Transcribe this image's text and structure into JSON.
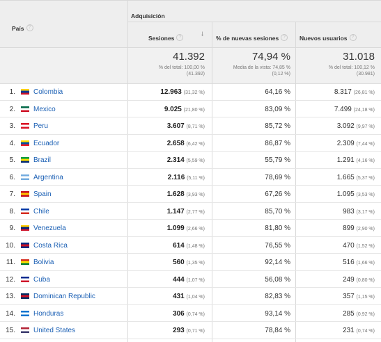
{
  "header": {
    "dimension_label": "País",
    "group_label": "Adquisición",
    "columns": [
      {
        "label": "Sesiones"
      },
      {
        "label": "% de nuevas sesiones"
      },
      {
        "label": "Nuevos usuarios"
      }
    ]
  },
  "totals": {
    "sesiones": {
      "value": "41.392",
      "line1": "% del total: 100,00 %",
      "line2": "(41.392)"
    },
    "nuevas": {
      "value": "74,94 %",
      "line1": "Media de la vista: 74,85 %",
      "line2": "(0,12 %)"
    },
    "nuevos_usuarios": {
      "value": "31.018",
      "line1": "% del total: 100,12 %",
      "line2": "(30.981)"
    }
  },
  "rows": [
    {
      "index": "1.",
      "country": "Colombia",
      "sesiones": "12.963",
      "sesiones_pct": "(31,32 %)",
      "nuevas": "64,16 %",
      "nuevos_usuarios": "8.317",
      "nu_pct": "(26,81 %)"
    },
    {
      "index": "2.",
      "country": "Mexico",
      "sesiones": "9.025",
      "sesiones_pct": "(21,80 %)",
      "nuevas": "83,09 %",
      "nuevos_usuarios": "7.499",
      "nu_pct": "(24,18 %)"
    },
    {
      "index": "3.",
      "country": "Peru",
      "sesiones": "3.607",
      "sesiones_pct": "(8,71 %)",
      "nuevas": "85,72 %",
      "nuevos_usuarios": "3.092",
      "nu_pct": "(9,97 %)"
    },
    {
      "index": "4.",
      "country": "Ecuador",
      "sesiones": "2.658",
      "sesiones_pct": "(6,42 %)",
      "nuevas": "86,87 %",
      "nuevos_usuarios": "2.309",
      "nu_pct": "(7,44 %)"
    },
    {
      "index": "5.",
      "country": "Brazil",
      "sesiones": "2.314",
      "sesiones_pct": "(5,59 %)",
      "nuevas": "55,79 %",
      "nuevos_usuarios": "1.291",
      "nu_pct": "(4,16 %)"
    },
    {
      "index": "6.",
      "country": "Argentina",
      "sesiones": "2.116",
      "sesiones_pct": "(5,11 %)",
      "nuevas": "78,69 %",
      "nuevos_usuarios": "1.665",
      "nu_pct": "(5,37 %)"
    },
    {
      "index": "7.",
      "country": "Spain",
      "sesiones": "1.628",
      "sesiones_pct": "(3,93 %)",
      "nuevas": "67,26 %",
      "nuevos_usuarios": "1.095",
      "nu_pct": "(3,53 %)"
    },
    {
      "index": "8.",
      "country": "Chile",
      "sesiones": "1.147",
      "sesiones_pct": "(2,77 %)",
      "nuevas": "85,70 %",
      "nuevos_usuarios": "983",
      "nu_pct": "(3,17 %)"
    },
    {
      "index": "9.",
      "country": "Venezuela",
      "sesiones": "1.099",
      "sesiones_pct": "(2,66 %)",
      "nuevas": "81,80 %",
      "nuevos_usuarios": "899",
      "nu_pct": "(2,90 %)"
    },
    {
      "index": "10.",
      "country": "Costa Rica",
      "sesiones": "614",
      "sesiones_pct": "(1,48 %)",
      "nuevas": "76,55 %",
      "nuevos_usuarios": "470",
      "nu_pct": "(1,52 %)"
    },
    {
      "index": "11.",
      "country": "Bolivia",
      "sesiones": "560",
      "sesiones_pct": "(1,35 %)",
      "nuevas": "92,14 %",
      "nuevos_usuarios": "516",
      "nu_pct": "(1,66 %)"
    },
    {
      "index": "12.",
      "country": "Cuba",
      "sesiones": "444",
      "sesiones_pct": "(1,07 %)",
      "nuevas": "56,08 %",
      "nuevos_usuarios": "249",
      "nu_pct": "(0,80 %)"
    },
    {
      "index": "13.",
      "country": "Dominican Republic",
      "sesiones": "431",
      "sesiones_pct": "(1,04 %)",
      "nuevas": "82,83 %",
      "nuevos_usuarios": "357",
      "nu_pct": "(1,15 %)"
    },
    {
      "index": "14.",
      "country": "Honduras",
      "sesiones": "306",
      "sesiones_pct": "(0,74 %)",
      "nuevas": "93,14 %",
      "nuevos_usuarios": "285",
      "nu_pct": "(0,92 %)"
    },
    {
      "index": "15.",
      "country": "United States",
      "sesiones": "293",
      "sesiones_pct": "(0,71 %)",
      "nuevas": "78,84 %",
      "nuevos_usuarios": "231",
      "nu_pct": "(0,74 %)"
    }
  ],
  "flags": [
    [
      "#fcd116",
      "#003893",
      "#ce1126"
    ],
    [
      "#006847",
      "#ffffff",
      "#ce1126"
    ],
    [
      "#d91023",
      "#ffffff",
      "#d91023"
    ],
    [
      "#ffdd00",
      "#034ea2",
      "#ed1c24"
    ],
    [
      "#009c3b",
      "#ffdf00",
      "#002776"
    ],
    [
      "#74acdf",
      "#ffffff",
      "#74acdf"
    ],
    [
      "#c60b1e",
      "#ffc400",
      "#c60b1e"
    ],
    [
      "#0039a6",
      "#ffffff",
      "#d52b1e"
    ],
    [
      "#ffcc00",
      "#00247d",
      "#cf142b"
    ],
    [
      "#002b7f",
      "#ce1126",
      "#002b7f"
    ],
    [
      "#d52b1e",
      "#f9e300",
      "#007934"
    ],
    [
      "#002a8f",
      "#ffffff",
      "#cf142b"
    ],
    [
      "#002d62",
      "#ce1126",
      "#002d62"
    ],
    [
      "#0073cf",
      "#ffffff",
      "#0073cf"
    ],
    [
      "#b22234",
      "#ffffff",
      "#3c3b6e"
    ]
  ]
}
